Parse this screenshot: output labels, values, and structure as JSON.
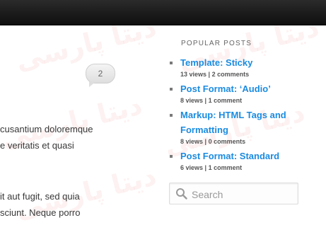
{
  "comment_count": "2",
  "excerpt_lines": [
    "cusantium doloremque",
    "e veritatis et quasi",
    "it aut fugit, sed quia",
    "sciunt. Neque porro"
  ],
  "popular_posts": {
    "title": "POPULAR POSTS",
    "items": [
      {
        "title": "Template: Sticky",
        "views": "13 views",
        "comments": "2 comments"
      },
      {
        "title": "Post Format: ‘Audio’",
        "views": "8 views",
        "comments": "1 comment"
      },
      {
        "title": "Markup: HTML Tags and Formatting",
        "views": "8 views",
        "comments": "0 comments"
      },
      {
        "title": "Post Format: Standard",
        "views": "6 views",
        "comments": "1 comment"
      }
    ]
  },
  "search": {
    "placeholder": "Search",
    "icon": "search-icon"
  },
  "watermark_text": "دیتا پارسی",
  "colors": {
    "link": "#1b8be0",
    "topbar": "#1a1a1a"
  }
}
